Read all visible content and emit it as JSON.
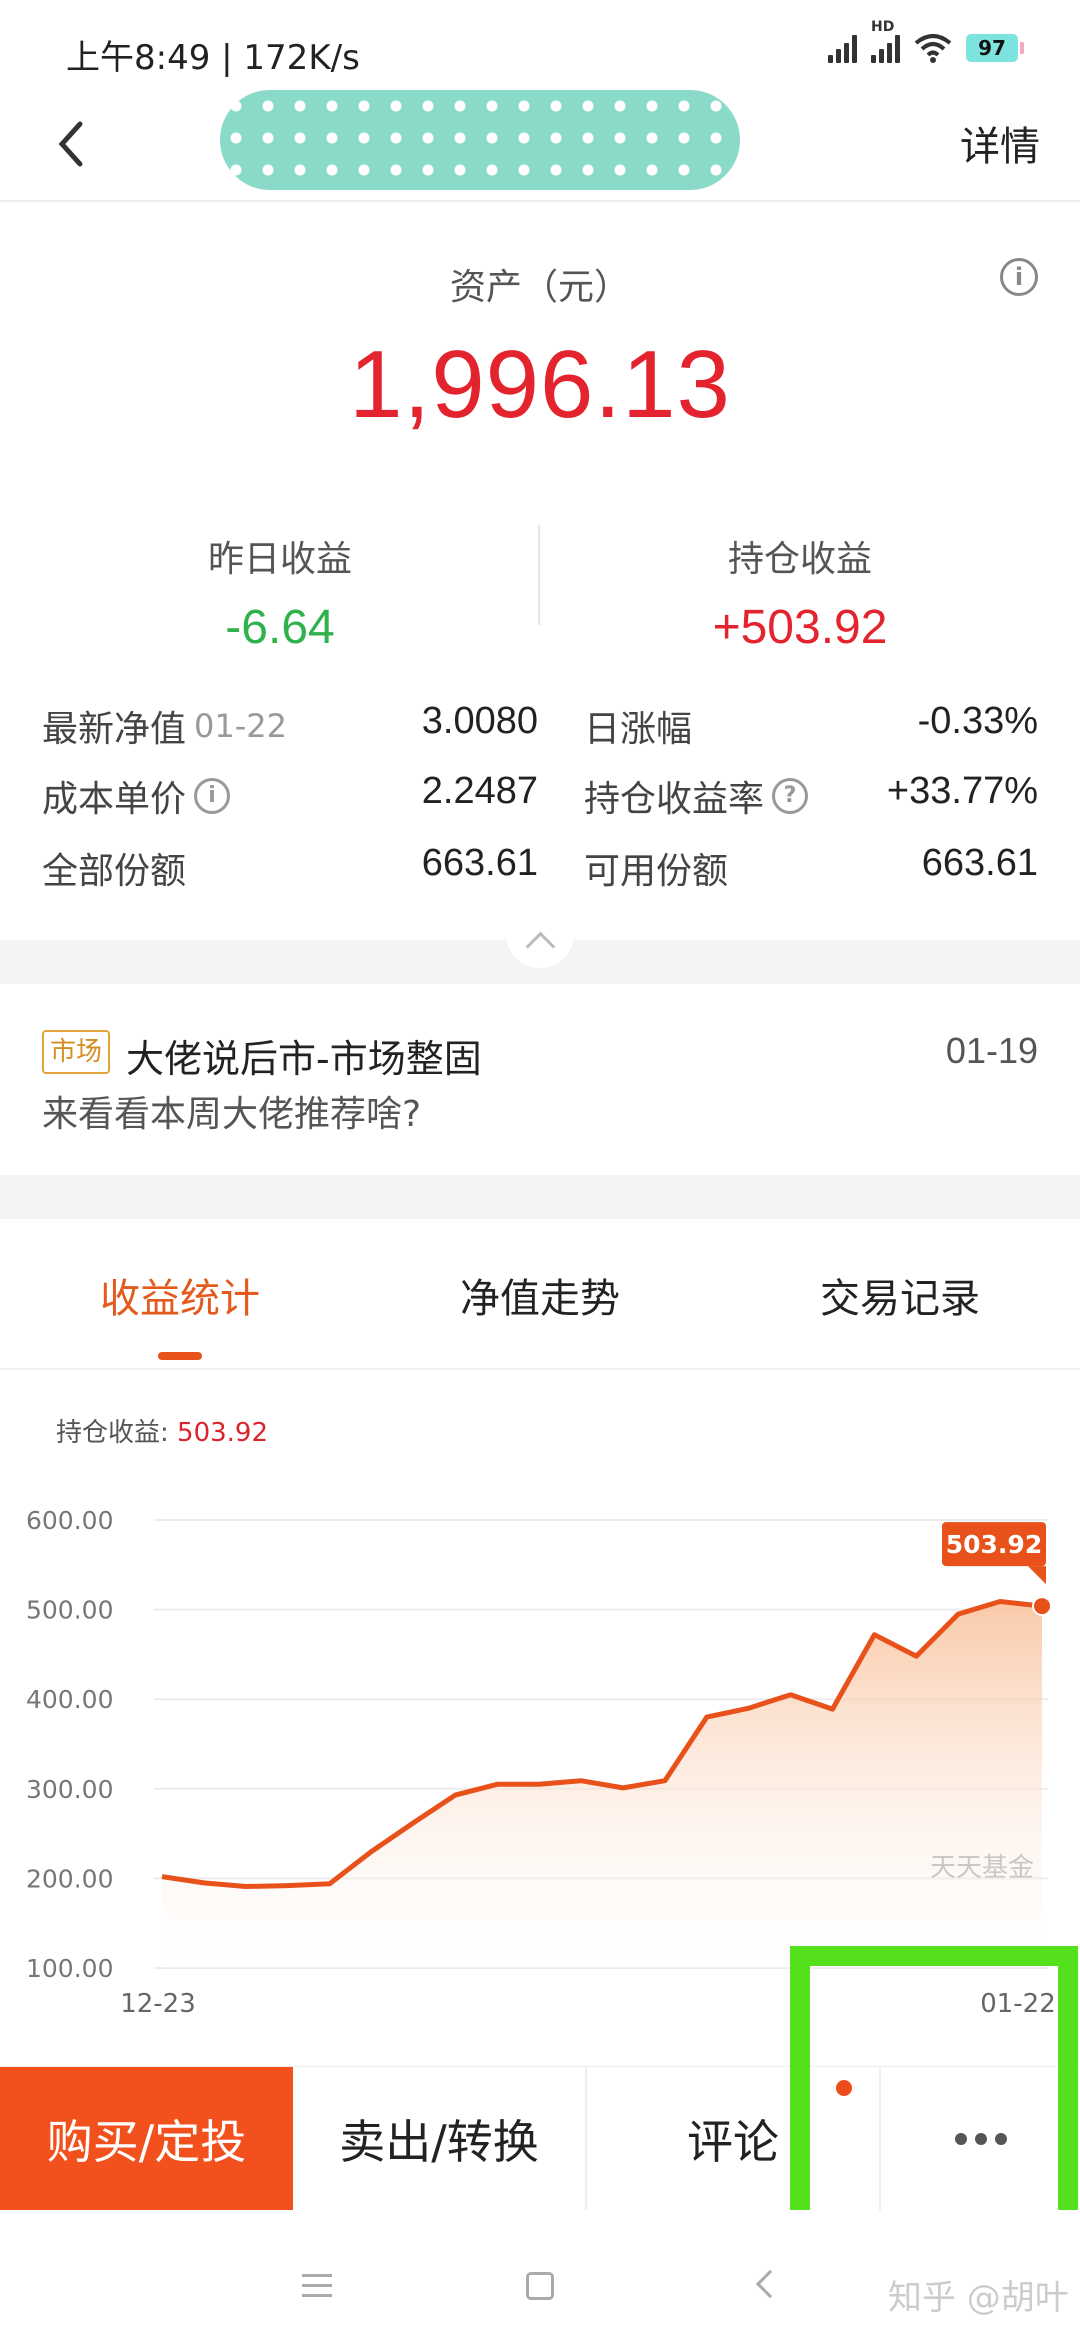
{
  "status": {
    "time": "上午8:49 | 172K/s",
    "battery": "97",
    "hd_label": "HD"
  },
  "nav": {
    "detail_label": "详情"
  },
  "asset": {
    "label": "资产（元）",
    "value": "1,996.13"
  },
  "stats": {
    "yesterday": {
      "label": "昨日收益",
      "value": "-6.64"
    },
    "holding": {
      "label": "持仓收益",
      "value": "+503.92"
    }
  },
  "details": {
    "nav_label": "最新净值",
    "nav_date": "01-22",
    "nav_value": "3.0080",
    "daily_label": "日涨幅",
    "daily_value": "-0.33%",
    "cost_label": "成本单价",
    "cost_value": "2.2487",
    "rate_label": "持仓收益率",
    "rate_value": "+33.77%",
    "shares_label": "全部份额",
    "shares_value": "663.61",
    "avail_label": "可用份额",
    "avail_value": "663.61"
  },
  "news": {
    "tag": "市场",
    "title": "大佬说后市-市场整固",
    "date": "01-19",
    "subtitle": "来看看本周大佬推荐啥?"
  },
  "tabs": [
    {
      "label": "收益统计"
    },
    {
      "label": "净值走势"
    },
    {
      "label": "交易记录"
    }
  ],
  "chart_caption": {
    "label": "持仓收益:",
    "value": "503.92"
  },
  "chart_data": {
    "type": "area",
    "ylim": [
      100,
      600
    ],
    "yticks": [
      "600.00",
      "500.00",
      "400.00",
      "300.00",
      "200.00",
      "100.00"
    ],
    "x_start_label": "12-23",
    "x_end_label": "01-22",
    "values": [
      202,
      195,
      191,
      192,
      194,
      230,
      262,
      293,
      305,
      305,
      309,
      301,
      309,
      380,
      390,
      405,
      389,
      472,
      448,
      495,
      509,
      503.92
    ],
    "last_label": "503.92",
    "watermark": "天天基金",
    "line_color": "#e8511a",
    "fill_color": "#f9c39f"
  },
  "actions": {
    "buy": "购买/定投",
    "sell": "卖出/转换",
    "comment": "评论"
  },
  "footer": {
    "watermark": "知乎 @胡叶"
  }
}
